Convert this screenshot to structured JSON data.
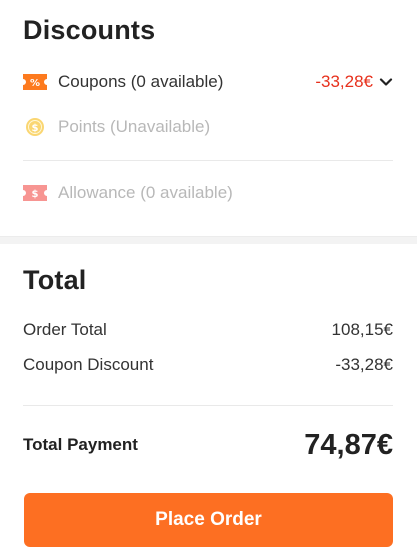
{
  "discounts": {
    "title": "Discounts",
    "coupons": {
      "label": "Coupons (0 available)",
      "amount": "-33,28€",
      "icon": "coupon-percent-icon"
    },
    "points": {
      "label": "Points (Unavailable)",
      "icon": "coin-icon"
    },
    "allowance": {
      "label": "Allowance (0 available)",
      "icon": "allowance-ticket-icon"
    }
  },
  "total": {
    "title": "Total",
    "order_total_label": "Order Total",
    "order_total_value": "108,15€",
    "coupon_discount_label": "Coupon Discount",
    "coupon_discount_value": "-33,28€",
    "payment_label": "Total Payment",
    "payment_value": "74,87€"
  },
  "actions": {
    "place_order": "Place Order"
  },
  "colors": {
    "accent": "#fd6f22",
    "discount_red": "#e7301c",
    "coin": "#f7b500"
  }
}
